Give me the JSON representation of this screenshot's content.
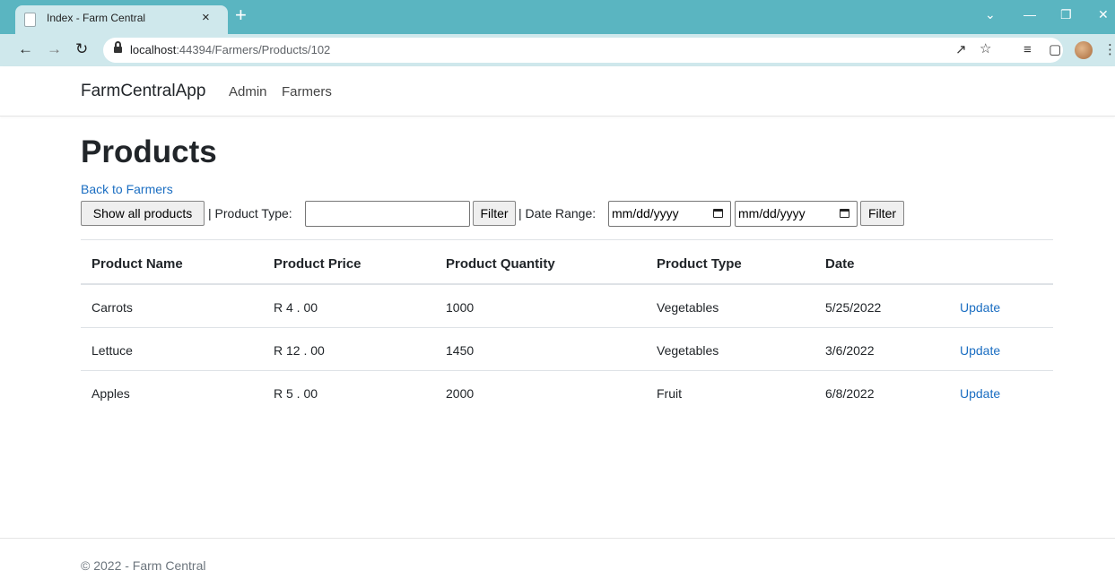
{
  "browser": {
    "tab_title": "Index - Farm Central",
    "tab_close": "×",
    "new_tab": "+",
    "url_host": "localhost",
    "url_path": ":44394/Farmers/Products/102",
    "icons": [
      "back-arrow-icon",
      "forward-arrow-icon",
      "reload-icon",
      "lock-icon",
      "share-icon",
      "star-icon",
      "reading-list-icon",
      "side-panel-icon",
      "profile-avatar-icon",
      "more-menu-icon"
    ]
  },
  "site_nav": {
    "brand": "FarmCentralApp",
    "links": [
      "Admin",
      "Farmers"
    ]
  },
  "page": {
    "title": "Products",
    "back_link": "Back to Farmers"
  },
  "filters": {
    "show_all_label": "Show all products",
    "product_type_label": "| Product Type:",
    "product_type_value": "",
    "filter_label": "Filter",
    "date_range_label": "| Date Range:",
    "date_from": "mm/dd/yyyy",
    "date_to": "mm/dd/yyyy",
    "filter2_label": "Filter"
  },
  "table": {
    "headers": [
      "Product Name",
      "Product Price",
      "Product Quantity",
      "Product Type",
      "Date"
    ],
    "rows": [
      {
        "name": "Carrots",
        "price": "R 4 . 00",
        "quantity": "1000",
        "type": "Vegetables",
        "date": "5/25/2022",
        "action": "Update"
      },
      {
        "name": "Lettuce",
        "price": "R 12 . 00",
        "quantity": "1450",
        "type": "Vegetables",
        "date": "3/6/2022",
        "action": "Update"
      },
      {
        "name": "Apples",
        "price": "R 5 . 00",
        "quantity": "2000",
        "type": "Fruit",
        "date": "6/8/2022",
        "action": "Update"
      }
    ]
  },
  "footer": {
    "text": "© 2022 - Farm Central"
  },
  "colors": {
    "chrome_tabstrip": "#5ab5c1",
    "chrome_toolbar": "#cfe8ec",
    "link": "#1b6ec2"
  }
}
